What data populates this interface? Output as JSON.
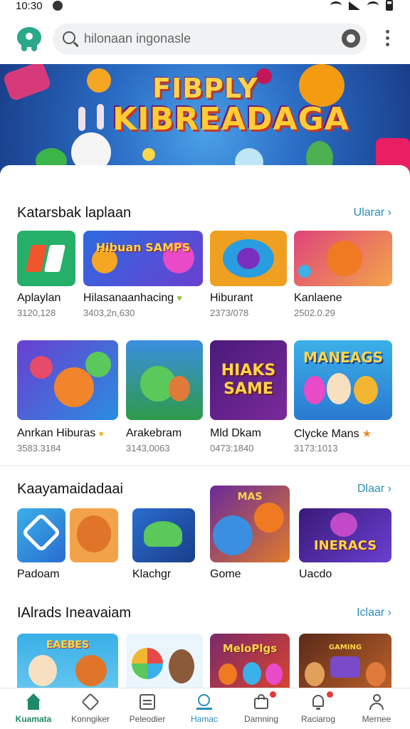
{
  "status_bar": {
    "time": "10:30"
  },
  "header": {
    "search_placeholder": "hilonaan ingonasle"
  },
  "banner": {
    "title_top": "FIBPLY",
    "title_main": "KIBREADAGA"
  },
  "sections": [
    {
      "title": "Katarsbak laplaan",
      "more": "Ularar ›",
      "rows": [
        [
          {
            "name": "Aplaylan",
            "count": "3120,128",
            "thumb_text": "",
            "badge": ""
          },
          {
            "name": "Hilasanaanhacing",
            "count": "3403,2n,630",
            "thumb_text": "Hibuan SAMPS",
            "badge": "heart"
          },
          {
            "name": "Hiburant",
            "count": "2373/078",
            "thumb_text": "",
            "badge": ""
          },
          {
            "name": "Kanlaene",
            "count": "2502.0.29",
            "thumb_text": "",
            "badge": ""
          }
        ],
        [
          {
            "name": "Anrkan Hiburas",
            "count": "3583.3184",
            "thumb_text": "",
            "badge": "star"
          },
          {
            "name": "Arakebram",
            "count": "3143,0063",
            "thumb_text": "",
            "badge": ""
          },
          {
            "name": "Mld Dkam",
            "count": "0473:1840",
            "thumb_text": "HIAKS SAME",
            "badge": ""
          },
          {
            "name": "Clycke Mans",
            "count": "3173:1013",
            "thumb_text": "MANEAGS",
            "badge": "star-orange"
          }
        ]
      ]
    },
    {
      "title": "Kaayamaidadaai",
      "more": "Dlaar ›",
      "items": [
        {
          "name": "Padoam",
          "thumb_text": ""
        },
        {
          "name": "Klachgr",
          "thumb_text": ""
        },
        {
          "name": "Gome",
          "thumb_text": "MAS"
        },
        {
          "name": "Uacdo",
          "thumb_text": "INERACS"
        }
      ]
    },
    {
      "title": "IAlrads Ineavaiam",
      "more": "Iclaar ›",
      "items": [
        {
          "thumb_text": "EAEBES"
        },
        {
          "thumb_text": ""
        },
        {
          "thumb_text": "MeloPlgs"
        },
        {
          "thumb_text": "GAMING"
        }
      ]
    }
  ],
  "bottom_nav": [
    {
      "label": "Kuamata",
      "icon": "home-icon",
      "active": true
    },
    {
      "label": "Konngiker",
      "icon": "tag-icon",
      "active": false
    },
    {
      "label": "Peleodier",
      "icon": "board-icon",
      "active": false
    },
    {
      "label": "Hamac",
      "icon": "search-icon",
      "active": false
    },
    {
      "label": "Damning",
      "icon": "bag-icon",
      "active": false,
      "badge": true
    },
    {
      "label": "Raciarog",
      "icon": "bell-icon",
      "active": false,
      "badge": true
    },
    {
      "label": "Mernee",
      "icon": "person-icon",
      "active": false
    }
  ],
  "colors": {
    "accent": "#1f8a6a",
    "link": "#2a8db8",
    "badge": "#e53935"
  }
}
